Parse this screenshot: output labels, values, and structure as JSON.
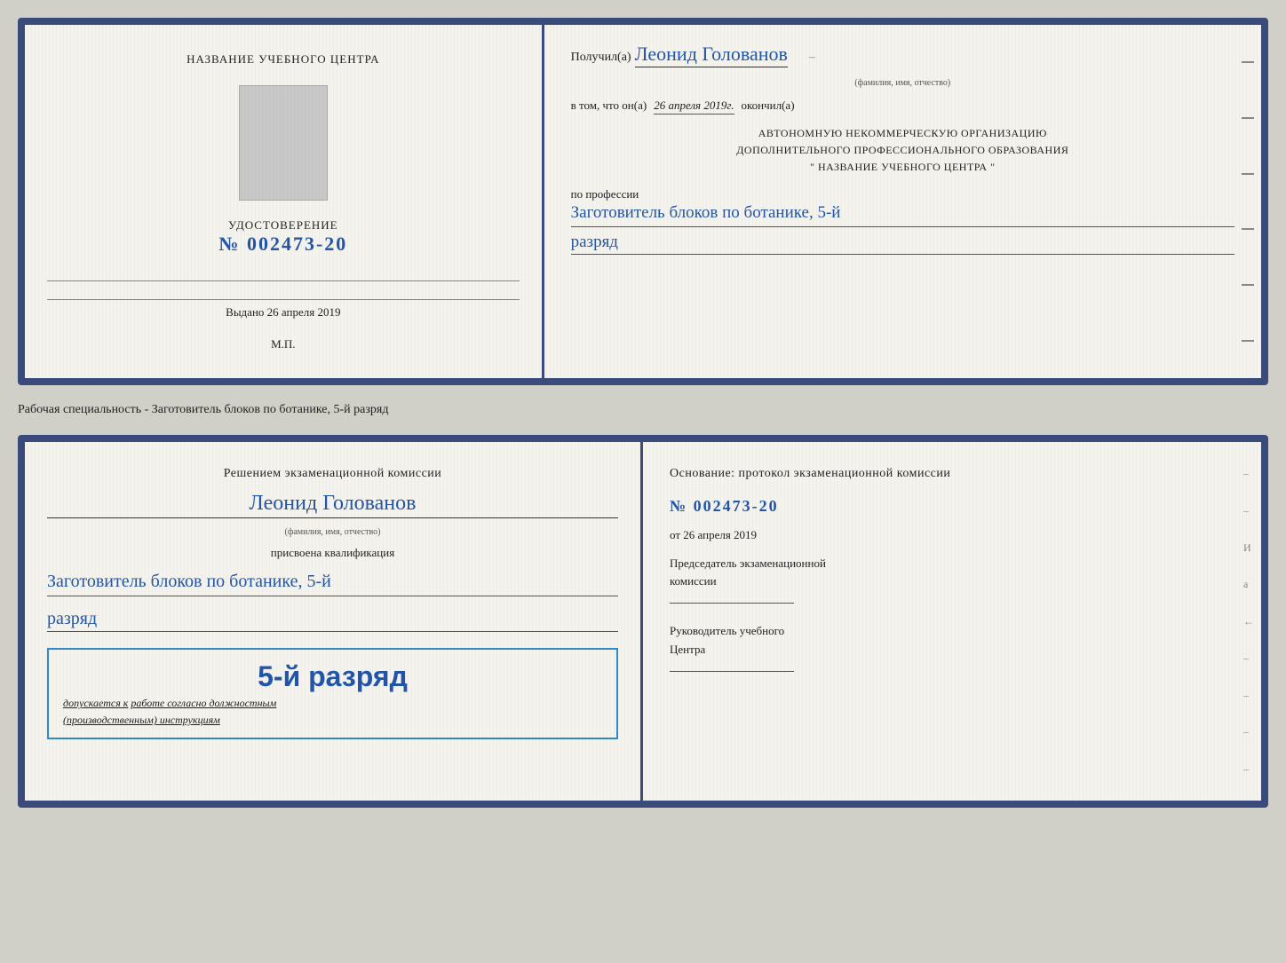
{
  "top_cert": {
    "left": {
      "title": "НАЗВАНИЕ УЧЕБНОГО ЦЕНТРА",
      "cert_label": "УДОСТОВЕРЕНИЕ",
      "cert_number_prefix": "№",
      "cert_number": "002473-20",
      "issued_label": "Выдано",
      "issued_date": "26 апреля 2019",
      "mp": "М.П."
    },
    "right": {
      "received_label": "Получил(а)",
      "person_name": "Леонид Голованов",
      "fio_label": "(фамилия, имя, отчество)",
      "date_prefix": "в том, что он(а)",
      "date_value": "26 апреля 2019г.",
      "completed_label": "окончил(а)",
      "org_line1": "АВТОНОМНУЮ НЕКОММЕРЧЕСКУЮ ОРГАНИЗАЦИЮ",
      "org_line2": "ДОПОЛНИТЕЛЬНОГО ПРОФЕССИОНАЛЬНОГО ОБРАЗОВАНИЯ",
      "org_line3": "\"  НАЗВАНИЕ УЧЕБНОГО ЦЕНТРА  \"",
      "profession_prefix": "по профессии",
      "profession_value": "Заготовитель блоков по ботанике, 5-й",
      "razryad_value": "разряд"
    }
  },
  "separator": {
    "text": "Рабочая специальность - Заготовитель блоков по ботанике, 5-й разряд"
  },
  "bottom_cert": {
    "left": {
      "decision_text": "Решением экзаменационной комиссии",
      "person_name": "Леонид Голованов",
      "fio_label": "(фамилия, имя, отчество)",
      "assigned_label": "присвоена квалификация",
      "qualification_value": "Заготовитель блоков по ботанике, 5-й",
      "razryad_value": "разряд",
      "stamp_rank": "5-й разряд",
      "stamp_allowed": "допускается к",
      "stamp_allowed_underline": "работе согласно должностным",
      "stamp_instructions": "(производственным) инструкциям"
    },
    "right": {
      "basis_text": "Основание: протокол экзаменационной комиссии",
      "protocol_prefix": "№",
      "protocol_number": "002473-20",
      "from_prefix": "от",
      "from_date": "26 апреля 2019",
      "chairman_line1": "Председатель экзаменационной",
      "chairman_line2": "комиссии",
      "director_line1": "Руководитель учебного",
      "director_line2": "Центра"
    }
  }
}
